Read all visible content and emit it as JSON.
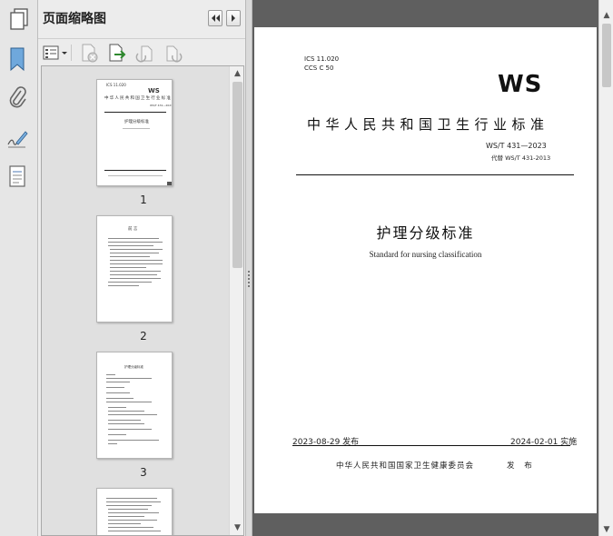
{
  "panel": {
    "title": "页面缩略图",
    "pages": [
      "1",
      "2",
      "3"
    ]
  },
  "document": {
    "ics_line": "ICS  11.020",
    "ccs_line": "CCS  C 50",
    "logo": "WS",
    "organization": "中华人民共和国卫生行业标准",
    "code": "WS/T 431—2023",
    "replaces": "代替 WS/T 431-2013",
    "title_cn": "护理分级标准",
    "title_en": "Standard for nursing classification",
    "publish_date": "2023-08-29 发布",
    "implement_date": "2024-02-01 实施",
    "publisher": "中华人民共和国国家卫生健康委员会",
    "publish_word": "发 布"
  },
  "thumbs": {
    "t1_logo": "WS",
    "t1_org": "中华人民共和国卫生行业标准",
    "t1_title": "护理分级标准",
    "t2_heading": "前 言",
    "t3_heading": "护理分级标准"
  }
}
